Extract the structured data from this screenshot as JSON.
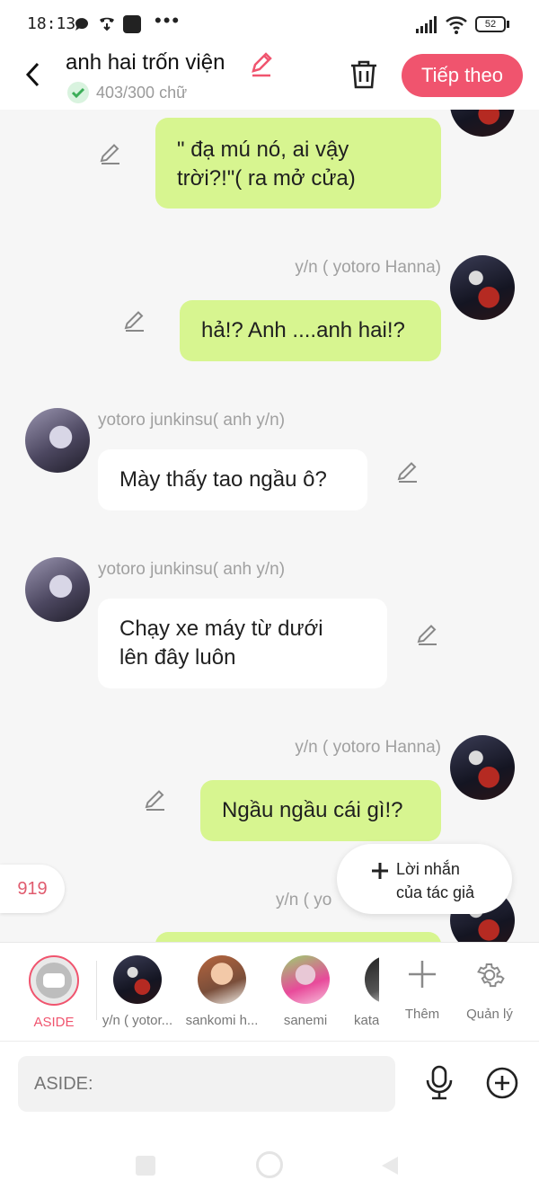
{
  "status_bar": {
    "time": "18:13",
    "battery": "52"
  },
  "header": {
    "title": "anh hai trốn viện",
    "word_count": "403/300 chữ",
    "next_label": "Tiếp theo"
  },
  "messages": [
    {
      "side": "right",
      "text_lines": [
        "\" đạ mú nó, ai vậy",
        "trời?!\"( ra mở cửa)"
      ]
    },
    {
      "side": "right",
      "name": "y/n ( yotoro Hanna)",
      "text_lines": [
        "hả!? Anh ....anh hai!?"
      ]
    },
    {
      "side": "left",
      "name": "yotoro junkinsu( anh y/n)",
      "text_lines": [
        "Mày thấy tao ngầu ô?"
      ]
    },
    {
      "side": "left",
      "name": "yotoro junkinsu( anh y/n)",
      "text_lines": [
        "Chạy xe máy từ dưới",
        "lên đây luôn"
      ]
    },
    {
      "side": "right",
      "name": "y/n ( yotoro Hanna)",
      "text_lines": [
        "Ngầu ngầu cái gì!?"
      ]
    },
    {
      "side": "right",
      "name": "y/n ( yo"
    }
  ],
  "floating": {
    "count": "919",
    "author_note_line1": "Lời nhắn",
    "author_note_line2": "của tác giả"
  },
  "characters": [
    {
      "label": "ASIDE"
    },
    {
      "label": "y/n ( yotor..."
    },
    {
      "label": "sankomi h..."
    },
    {
      "label": "sanemi"
    },
    {
      "label": "kata"
    }
  ],
  "actions": {
    "add_label": "Thêm",
    "manage_label": "Quản lý"
  },
  "input": {
    "placeholder": "ASIDE:"
  },
  "colors": {
    "accent": "#f0546e",
    "bubble_green": "#d7f590",
    "bubble_white": "#ffffff",
    "background": "#f6f6f6"
  },
  "icons": [
    "chat-bubble-icon",
    "call-icon",
    "square-icon",
    "more-icon",
    "signal-icon",
    "wifi-icon",
    "battery-icon",
    "back-icon",
    "pencil-icon",
    "check-circle-icon",
    "trash-icon",
    "edit-icon",
    "plus-icon",
    "gear-icon",
    "microphone-icon",
    "add-circle-icon",
    "aside-icon"
  ]
}
